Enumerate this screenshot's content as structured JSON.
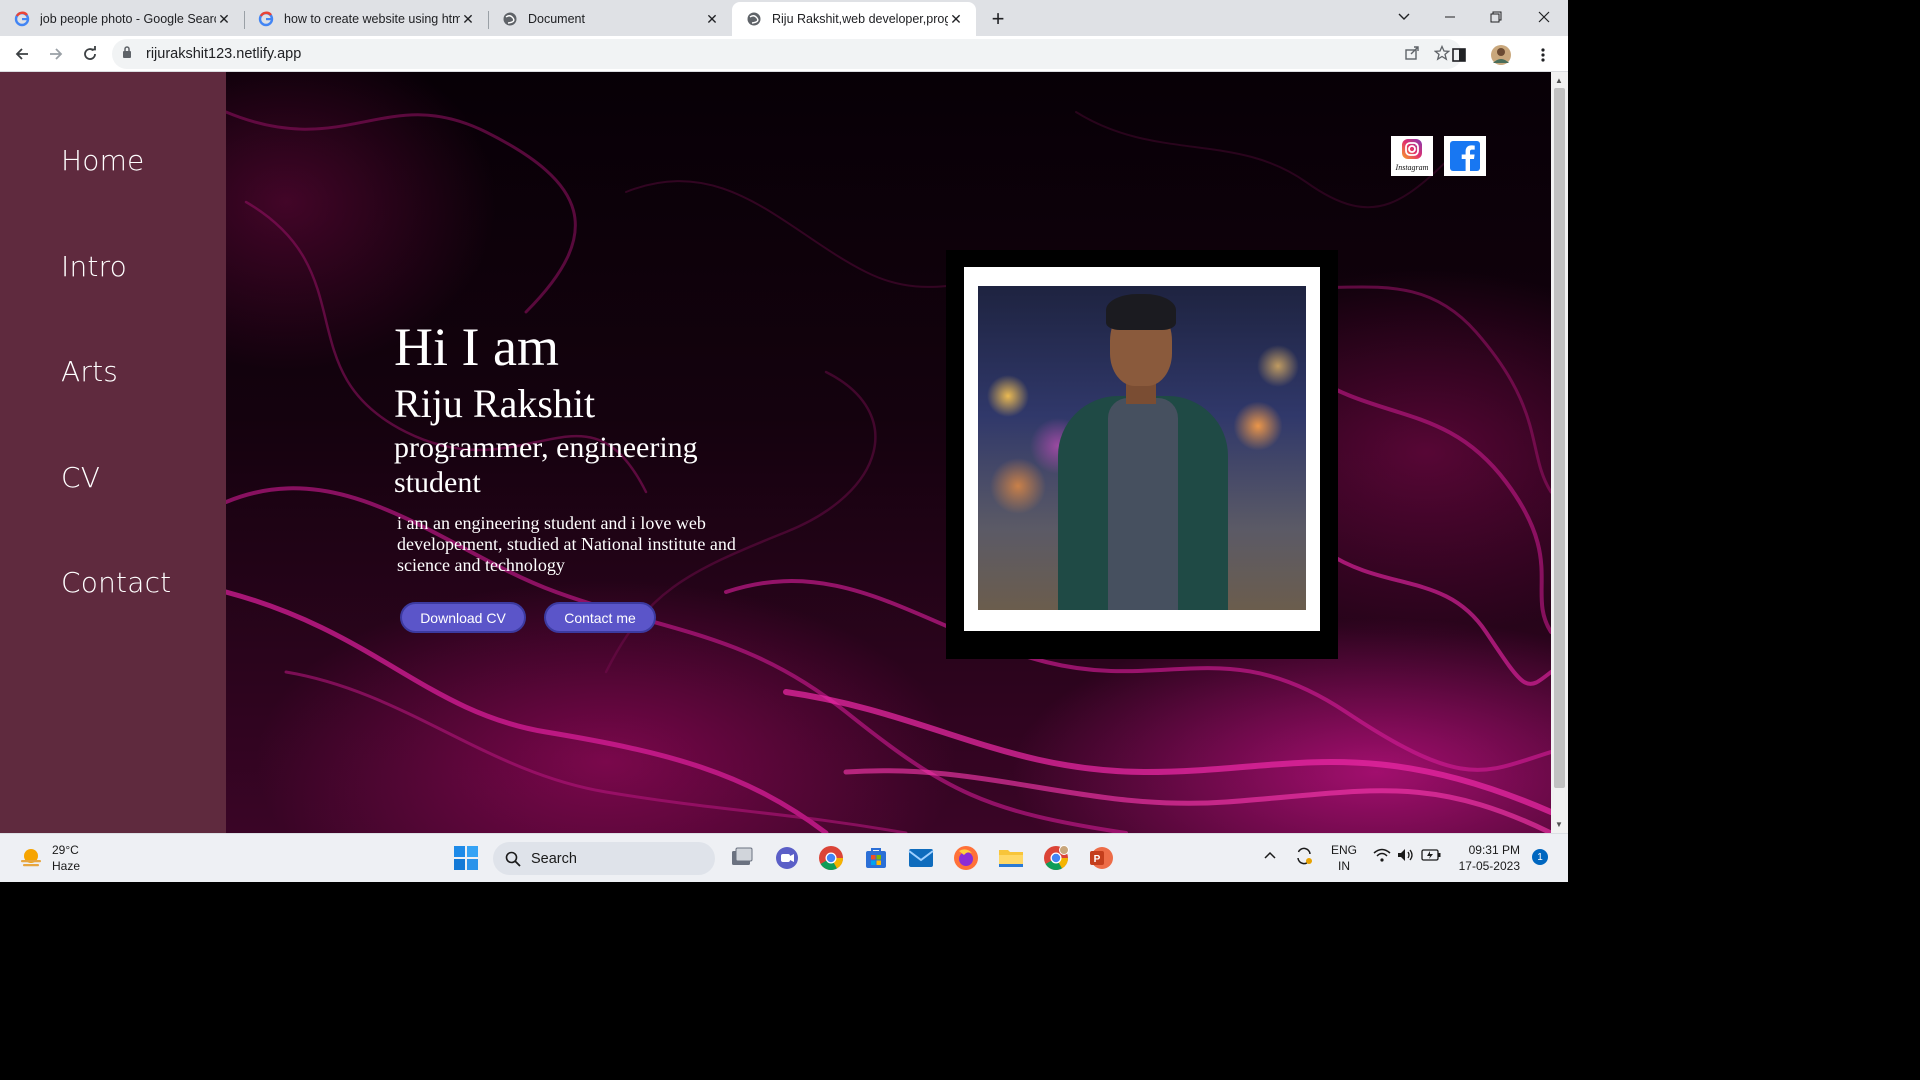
{
  "browser": {
    "tabs": [
      {
        "title": "job people photo - Google Searc",
        "icon": "google-icon"
      },
      {
        "title": "how to create website using html",
        "icon": "google-icon"
      },
      {
        "title": "Document",
        "icon": "globe-icon"
      },
      {
        "title": "Riju Rakshit,web developer,progr",
        "icon": "globe-icon",
        "active": true
      }
    ],
    "url": "rijurakshit123.netlify.app"
  },
  "sidebar": {
    "items": [
      {
        "label": "Home"
      },
      {
        "label": "Intro"
      },
      {
        "label": "Arts"
      },
      {
        "label": "CV"
      },
      {
        "label": "Contact"
      }
    ],
    "background": "#5f2a3e"
  },
  "hero": {
    "greeting": "Hi I am",
    "name": "Riju Rakshit",
    "role": "programmer, engineering student",
    "description": "i am an engineering student and i love web developement, studied at National institute and science and technology",
    "buttons": {
      "download_cv": "Download CV",
      "contact_me": "Contact me"
    },
    "button_color": "#5b55c9",
    "social": {
      "instagram_caption": "Instagram"
    }
  },
  "taskbar": {
    "weather": {
      "temp": "29°C",
      "condition": "Haze"
    },
    "search_label": "Search",
    "language": {
      "line1": "ENG",
      "line2": "IN"
    },
    "clock": {
      "time": "09:31 PM",
      "date": "17-05-2023"
    },
    "notifications": "1"
  }
}
